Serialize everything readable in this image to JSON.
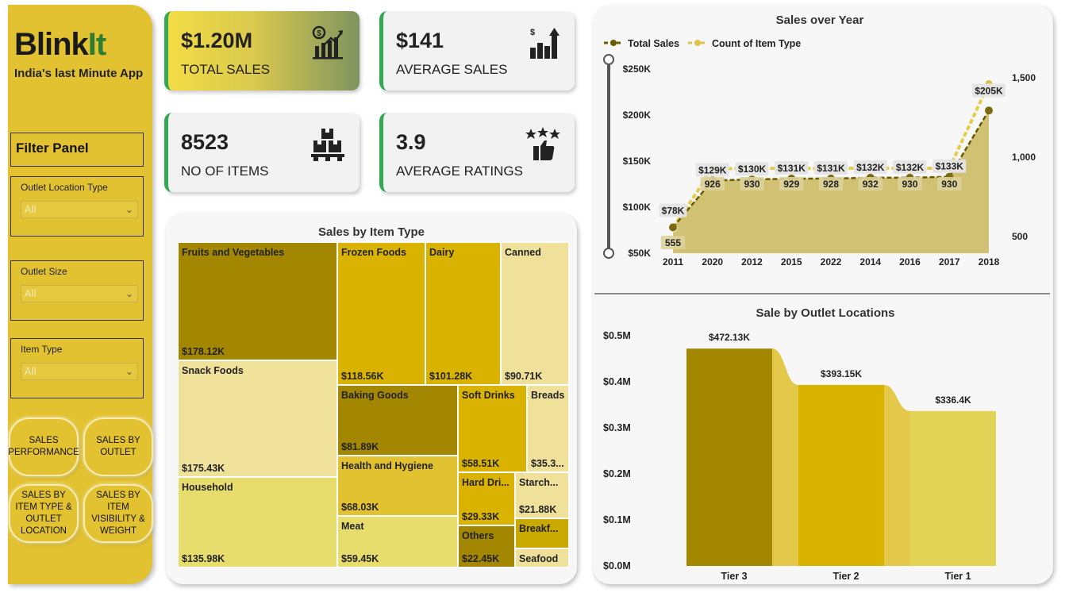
{
  "brand": {
    "name_a": "Blink",
    "name_b": "It",
    "tagline": "India's last Minute App"
  },
  "filters": {
    "title": "Filter Panel",
    "items": [
      {
        "label": "Outlet Location Type",
        "value": "All"
      },
      {
        "label": "Outlet Size",
        "value": "All"
      },
      {
        "label": "Item Type",
        "value": "All"
      }
    ]
  },
  "nav": [
    {
      "label": "SALES PERFORMANCE"
    },
    {
      "label": "SALES BY OUTLET"
    },
    {
      "label": "SALES BY ITEM TYPE & OUTLET LOCATION"
    },
    {
      "label": "SALES BY ITEM VISIBILITY & WEIGHT"
    }
  ],
  "kpis": {
    "total_sales": {
      "value": "$1.20M",
      "label": "TOTAL SALES",
      "icon": "dollar-growth-chart-icon"
    },
    "average_sales": {
      "value": "$141",
      "label": "AVERAGE SALES",
      "icon": "bar-chart-arrow-icon"
    },
    "no_of_items": {
      "value": "8523",
      "label": "NO OF ITEMS",
      "icon": "boxes-on-pallet-icon"
    },
    "average_ratings": {
      "value": "3.9",
      "label": "AVERAGE RATINGS",
      "icon": "thumbs-up-stars-icon"
    }
  },
  "colors": {
    "accent": "#e3c231",
    "dark": "#a38700",
    "mid": "#d9b300",
    "light": "#e6dd6d",
    "pale": "#efe19a",
    "kpi_border": "#34a853"
  },
  "treemap": {
    "title": "Sales by Item Type",
    "items": [
      {
        "name": "Fruits and Vegetables",
        "value": "$178.12K"
      },
      {
        "name": "Snack Foods",
        "value": "$175.43K"
      },
      {
        "name": "Household",
        "value": "$135.98K"
      },
      {
        "name": "Frozen Foods",
        "value": "$118.56K"
      },
      {
        "name": "Dairy",
        "value": "$101.28K"
      },
      {
        "name": "Canned",
        "value": "$90.71K"
      },
      {
        "name": "Baking Goods",
        "value": "$81.89K"
      },
      {
        "name": "Health and Hygiene",
        "value": "$68.03K"
      },
      {
        "name": "Meat",
        "value": "$59.45K"
      },
      {
        "name": "Soft Drinks",
        "value": "$58.51K"
      },
      {
        "name": "Breads",
        "value": "$35.3..."
      },
      {
        "name": "Hard Dri...",
        "value": "$29.33K"
      },
      {
        "name": "Others",
        "value": "$22.45K"
      },
      {
        "name": "Starch...",
        "value": "$21.88K"
      },
      {
        "name": "Breakf...",
        "value": ""
      },
      {
        "name": "Seafood",
        "value": ""
      }
    ]
  },
  "chart_data": [
    {
      "type": "area",
      "title": "Sales over Year",
      "categories": [
        "2011",
        "2020",
        "2012",
        "2015",
        "2022",
        "2014",
        "2016",
        "2017",
        "2018"
      ],
      "series": [
        {
          "name": "Total Sales",
          "axis": "left",
          "values": [
            78,
            129,
            130,
            131,
            131,
            132,
            132,
            133,
            205
          ],
          "labels": [
            "$78K",
            "$129K",
            "$130K",
            "$131K",
            "$131K",
            "$132K",
            "$132K",
            "$133K",
            "$205K"
          ]
        },
        {
          "name": "Count of Item Type",
          "axis": "right",
          "values": [
            555,
            926,
            930,
            929,
            928,
            932,
            930,
            930,
            1463
          ],
          "labels": [
            "555",
            "926",
            "930",
            "929",
            "928",
            "932",
            "930",
            "930",
            ""
          ]
        }
      ],
      "left_ticks": [
        "$250K",
        "$200K",
        "$150K",
        "$100K",
        "$50K"
      ],
      "right_ticks": [
        "1,500",
        "1,000",
        "500"
      ],
      "ylim_left": [
        50,
        250
      ],
      "ylim_right": [
        400,
        1550
      ],
      "legend": "top-left"
    },
    {
      "type": "bar",
      "title": "Sale by Outlet Locations",
      "categories": [
        "Tier 3",
        "Tier 2",
        "Tier 1"
      ],
      "values": [
        472.13,
        393.15,
        336.4
      ],
      "labels": [
        "$472.13K",
        "$393.15K",
        "$336.4K"
      ],
      "ticks": [
        "$0.5M",
        "$0.4M",
        "$0.3M",
        "$0.2M",
        "$0.1M",
        "$0.0M"
      ],
      "ylim": [
        0,
        500
      ]
    }
  ]
}
